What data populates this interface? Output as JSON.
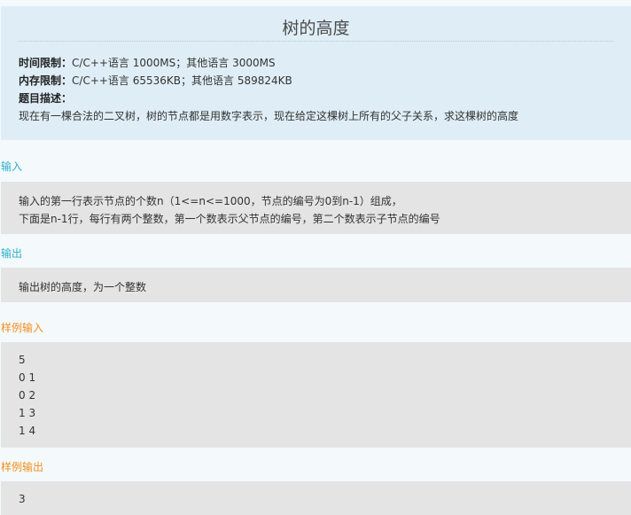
{
  "title": "树的高度",
  "meta": {
    "time_label": "时间限制：",
    "time_value": "C/C++语言 1000MS；其他语言 3000MS",
    "memory_label": "内存限制：",
    "memory_value": "C/C++语言 65536KB；其他语言 589824KB",
    "desc_label": "题目描述：",
    "desc_text": "现在有一棵合法的二叉树，树的节点都是用数字表示，现在给定这棵树上所有的父子关系，求这棵树的高度"
  },
  "input": {
    "label": "输入",
    "lines": [
      "输入的第一行表示节点的个数n（1<=n<=1000，节点的编号为0到n-1）组成，",
      "下面是n-1行，每行有两个整数，第一个数表示父节点的编号，第二个数表示子节点的编号"
    ]
  },
  "output": {
    "label": "输出",
    "text": "输出树的高度，为一个整数"
  },
  "sample_input": {
    "label": "样例输入",
    "lines": [
      "5",
      "0 1",
      "0 2",
      "1 3",
      "1 4"
    ]
  },
  "sample_output": {
    "label": "样例输出",
    "text": "3"
  },
  "colors": {
    "header_bg": "#dfeef6",
    "section_blue": "#2bb0c9",
    "section_orange": "#f0901c",
    "box_gray": "#e4e4e4"
  }
}
